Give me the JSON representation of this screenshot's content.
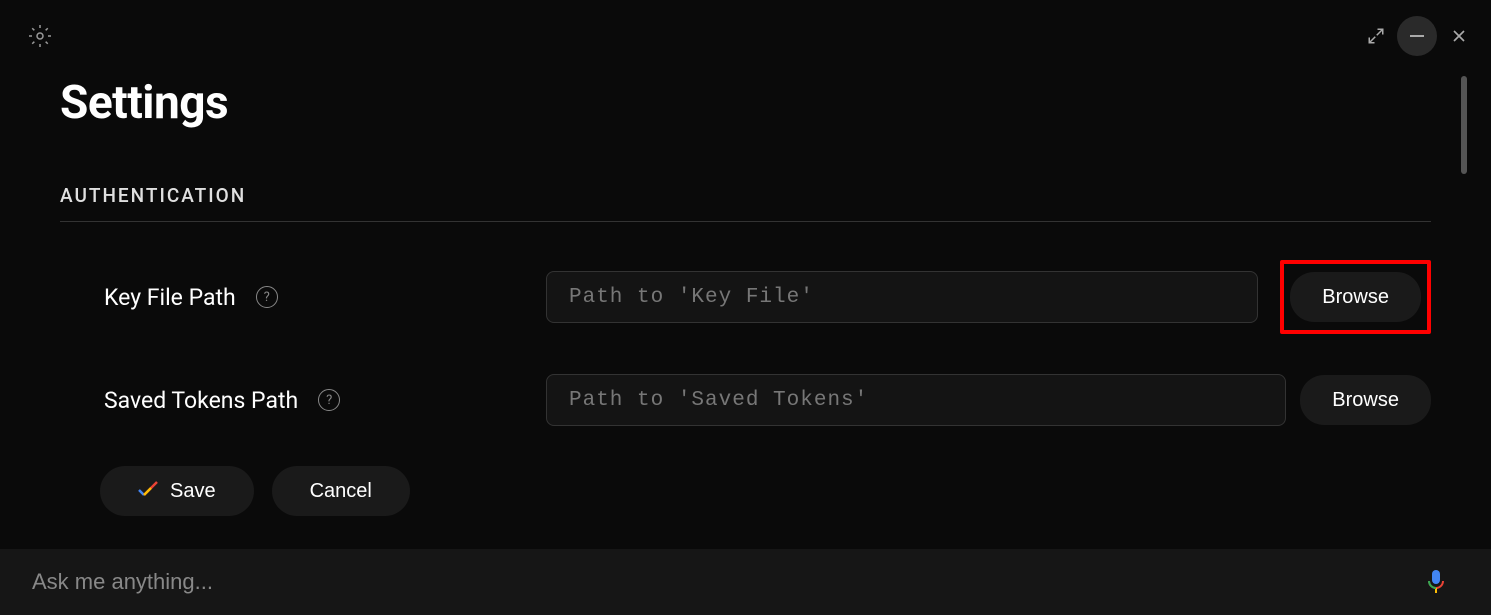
{
  "page": {
    "title": "Settings"
  },
  "section": {
    "header": "AUTHENTICATION"
  },
  "fields": {
    "key_file": {
      "label": "Key File Path",
      "placeholder": "Path to 'Key File'",
      "value": "",
      "browse_label": "Browse"
    },
    "saved_tokens": {
      "label": "Saved Tokens Path",
      "placeholder": "Path to 'Saved Tokens'",
      "value": "",
      "browse_label": "Browse"
    }
  },
  "buttons": {
    "save": "Save",
    "cancel": "Cancel"
  },
  "bottom": {
    "placeholder": "Ask me anything..."
  },
  "help_symbol": "?"
}
